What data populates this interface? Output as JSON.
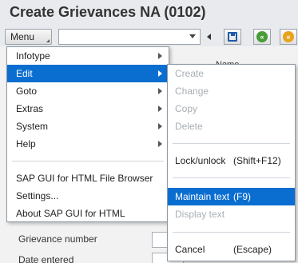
{
  "window": {
    "title": "Create Grievances NA (0102)"
  },
  "toolbar": {
    "menu_label": "Menu",
    "command_field_value": "",
    "icons": [
      "save-icon",
      "back-icon",
      "exit-icon"
    ]
  },
  "form": {
    "column_header": "Name",
    "fields": [
      {
        "label": "Grievance number",
        "value": ""
      },
      {
        "label": "Date entered",
        "value": ""
      }
    ]
  },
  "main_menu": {
    "items": [
      {
        "label": "Infotype",
        "submenu": true
      },
      {
        "label": "Edit",
        "submenu": true,
        "active": true
      },
      {
        "label": "Goto",
        "submenu": true
      },
      {
        "label": "Extras",
        "submenu": true
      },
      {
        "label": "System",
        "submenu": true
      },
      {
        "label": "Help",
        "submenu": true
      },
      {
        "label": "SAP GUI for HTML File Browser"
      },
      {
        "label": "Settings..."
      },
      {
        "label": "About SAP GUI for HTML"
      }
    ]
  },
  "edit_submenu": {
    "items": [
      {
        "label": "Create",
        "enabled": false
      },
      {
        "label": "Change",
        "enabled": false
      },
      {
        "label": "Copy",
        "enabled": false
      },
      {
        "label": "Delete",
        "enabled": false
      },
      {
        "label": "Lock/unlock",
        "shortcut": "(Shift+F12)",
        "enabled": true
      },
      {
        "label": "Maintain text",
        "shortcut": "(F9)",
        "enabled": true,
        "active": true
      },
      {
        "label": "Display text",
        "enabled": false
      },
      {
        "label": "Cancel",
        "shortcut": "(Escape)",
        "enabled": true
      }
    ]
  },
  "colors": {
    "highlight": "#0a6ed1",
    "disabled_text": "#a9afb5"
  }
}
